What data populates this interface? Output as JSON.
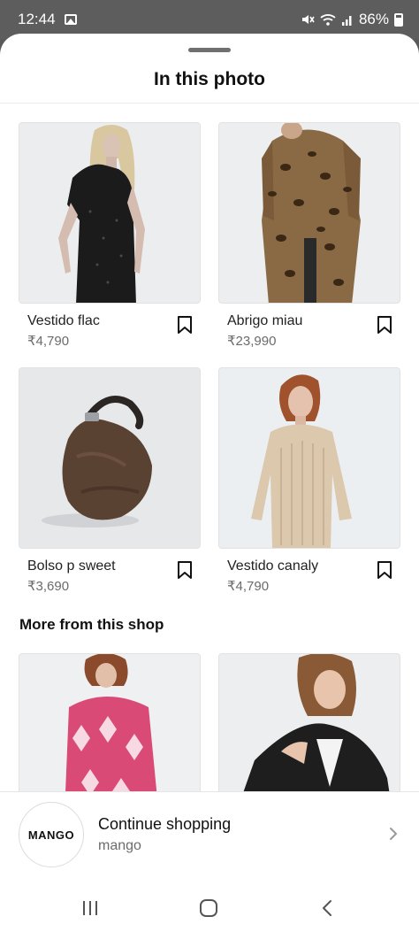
{
  "status_bar": {
    "time": "12:44",
    "battery": "86%",
    "gallery_icon": "image-notification-icon",
    "system_icons": "mute-icon wifi-icon signal-icon"
  },
  "sheet": {
    "title": "In this photo"
  },
  "products": [
    {
      "name": "Vestido flac",
      "price": "₹4,790"
    },
    {
      "name": "Abrigo miau",
      "price": "₹23,990"
    },
    {
      "name": "Bolso p sweet",
      "price": "₹3,690"
    },
    {
      "name": "Vestido canaly",
      "price": "₹4,790"
    }
  ],
  "more_section": {
    "heading": "More from this shop"
  },
  "shop": {
    "logo_text": "MANGO",
    "action": "Continue shopping",
    "name": "mango"
  },
  "colors": {
    "sheet_bg": "#ffffff",
    "status_bg": "#5d5d5d",
    "price_gray": "#6b6b6b"
  }
}
